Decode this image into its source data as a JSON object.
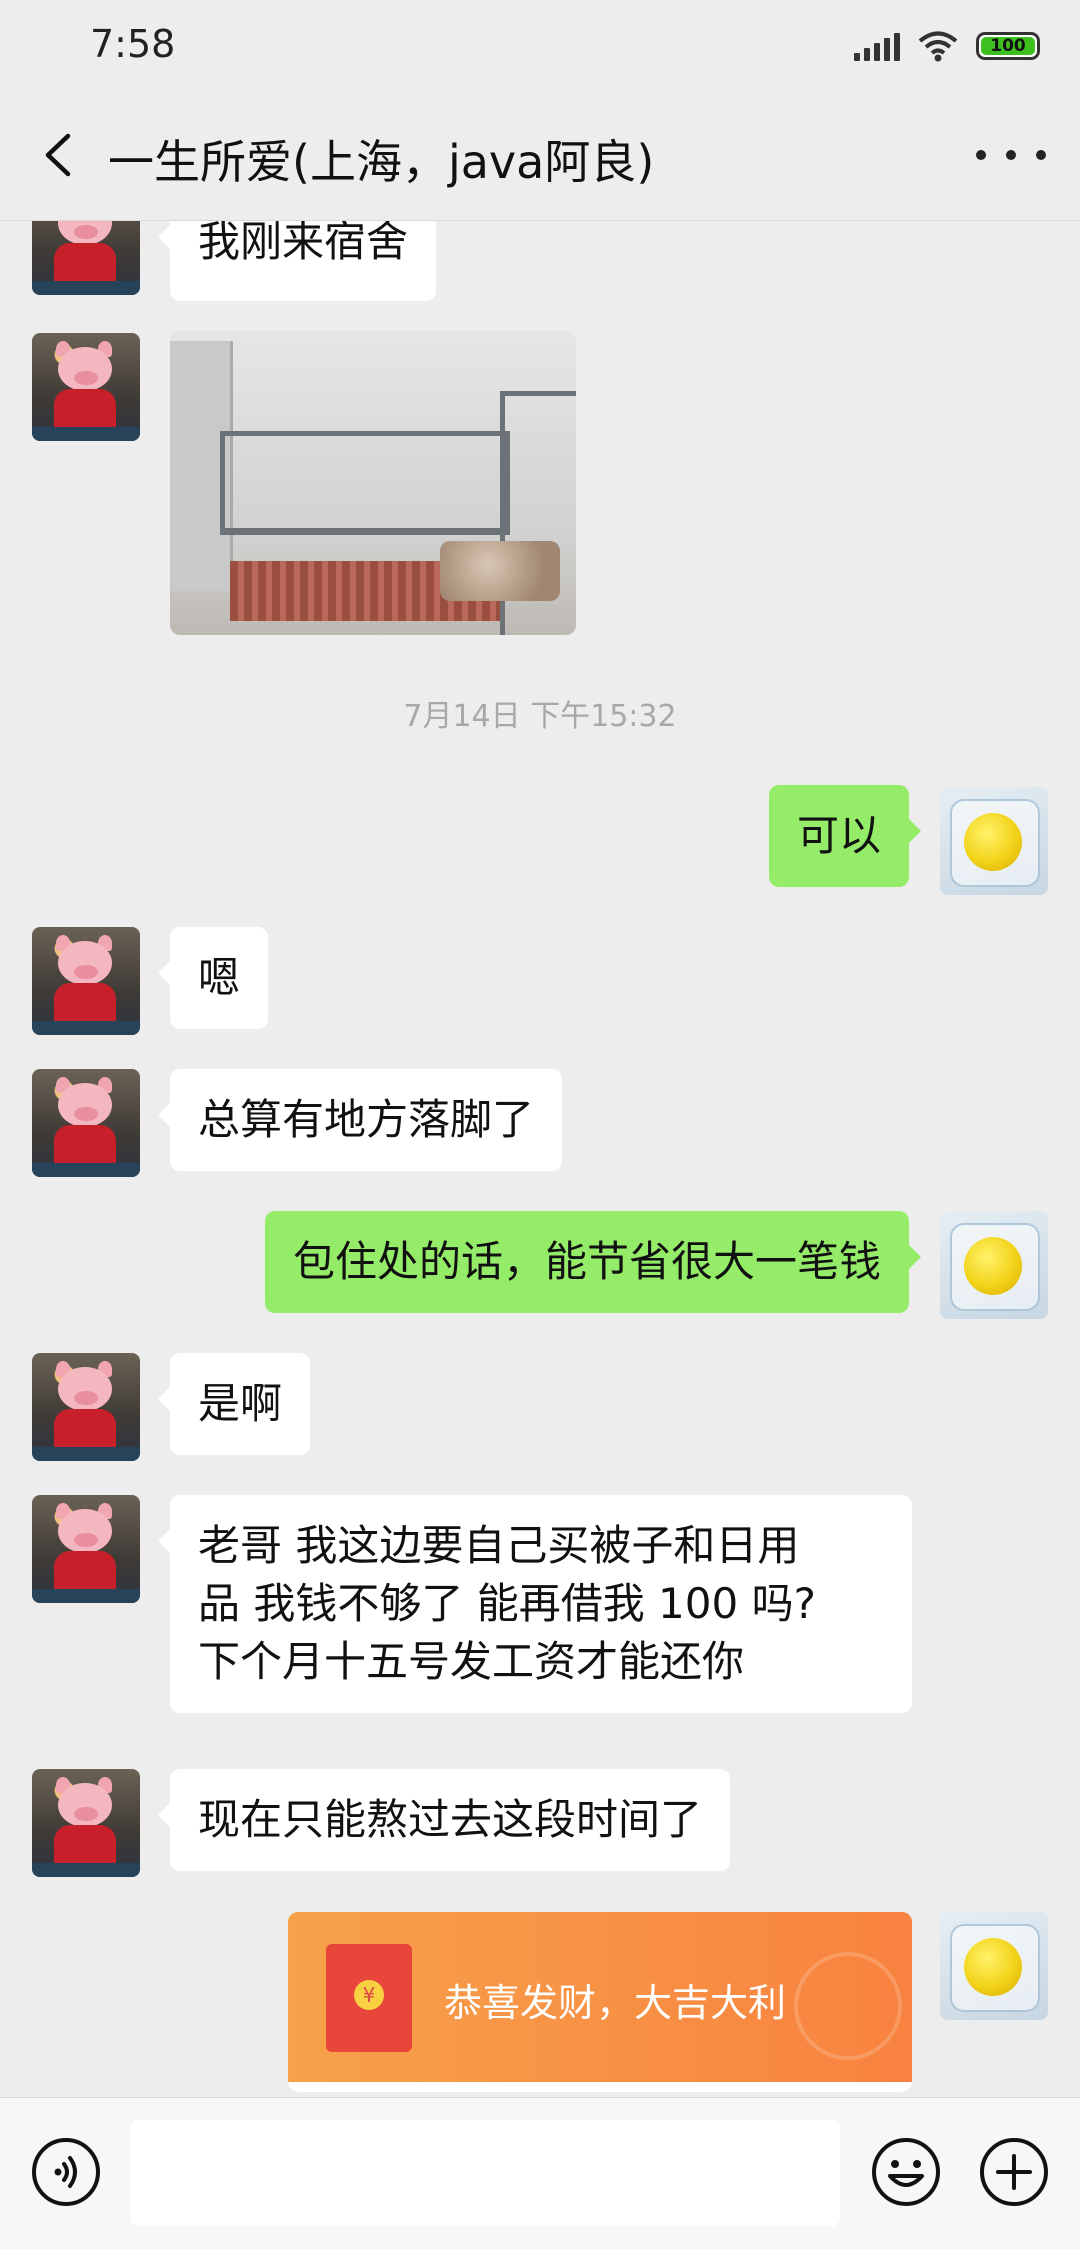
{
  "status_bar": {
    "time": "7:58",
    "battery": "100"
  },
  "header": {
    "title": "一生所爱(上海，java阿良)"
  },
  "messages": {
    "m1": "我刚来宿舍",
    "timestamp": "7月14日 下午15:32",
    "m2": "可以",
    "m3": "嗯",
    "m4": "总算有地方落脚了",
    "m5": "包住处的话，能节省很大一笔钱",
    "m6": "是啊",
    "m7": {
      "line1": "老哥  我这边要自己买被子和日用",
      "line2": "品    我钱不够了   能再借我 100 吗?",
      "line3": "下个月十五号发工资才能还你"
    },
    "m8": "现在只能熬过去这段时间了",
    "red_packet": {
      "text": "恭喜发财，大吉大利",
      "coin": "¥"
    }
  },
  "input_bar": {
    "text_value": ""
  },
  "icons": {
    "back": "back-icon",
    "more": "more-icon",
    "voice": "voice-icon",
    "emoji": "emoji-icon",
    "plus": "plus-icon"
  },
  "colors": {
    "background": "#EDEDED",
    "outgoing_bubble": "#95EC69",
    "incoming_bubble": "#FFFFFF",
    "red_packet": "#F8823F"
  }
}
